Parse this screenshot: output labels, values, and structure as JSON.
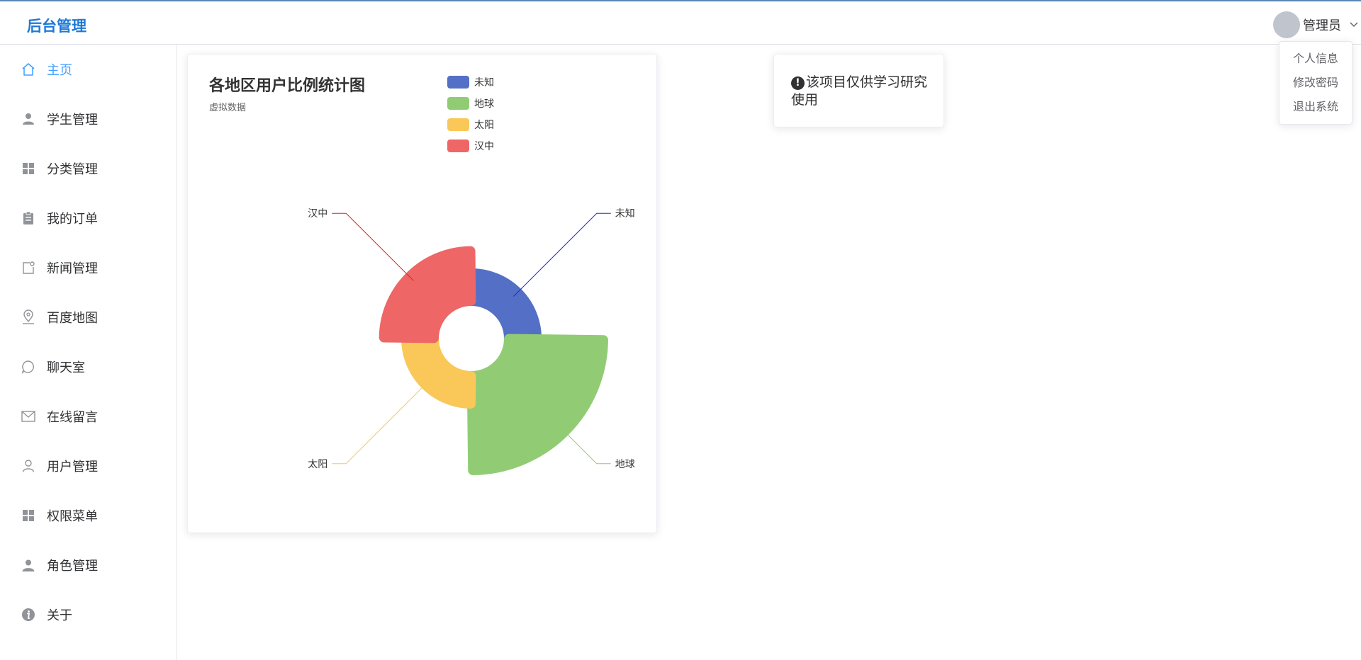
{
  "app": {
    "title": "后台管理"
  },
  "user": {
    "name": "管理员"
  },
  "dropdown": {
    "items": [
      "个人信息",
      "修改密码",
      "退出系统"
    ]
  },
  "sidebar": {
    "items": [
      {
        "label": "主页",
        "icon": "home-icon",
        "active": true
      },
      {
        "label": "学生管理",
        "icon": "user-solid-icon"
      },
      {
        "label": "分类管理",
        "icon": "menu-grid-icon"
      },
      {
        "label": "我的订单",
        "icon": "clipboard-icon"
      },
      {
        "label": "新闻管理",
        "icon": "news-icon"
      },
      {
        "label": "百度地图",
        "icon": "map-location-icon"
      },
      {
        "label": "聊天室",
        "icon": "chat-icon"
      },
      {
        "label": "在线留言",
        "icon": "message-icon"
      },
      {
        "label": "用户管理",
        "icon": "user-icon"
      },
      {
        "label": "权限菜单",
        "icon": "menu-grid-icon"
      },
      {
        "label": "角色管理",
        "icon": "avatar-icon"
      },
      {
        "label": "关于",
        "icon": "info-icon"
      }
    ]
  },
  "notice": {
    "text": "该项目仅供学习研究使用",
    "icon": "warning-icon"
  },
  "colors": {
    "accent": "#409eff",
    "brand": "#1e78d7",
    "unknown": "#5470c6",
    "earth": "#91cc75",
    "sun": "#fac858",
    "hanzhong": "#ee6666"
  },
  "chart_data": {
    "type": "pie",
    "subtype": "nightingale-rose-area",
    "title": "各地区用户比例统计图",
    "subtitle": "虚拟数据",
    "legend_position": "top",
    "series": [
      {
        "name": "未知",
        "value": 40,
        "color": "#5470c6"
      },
      {
        "name": "地球",
        "value": 100,
        "color": "#91cc75"
      },
      {
        "name": "太阳",
        "value": 40,
        "color": "#fac858"
      },
      {
        "name": "汉中",
        "value": 60,
        "color": "#ee6666"
      }
    ]
  }
}
